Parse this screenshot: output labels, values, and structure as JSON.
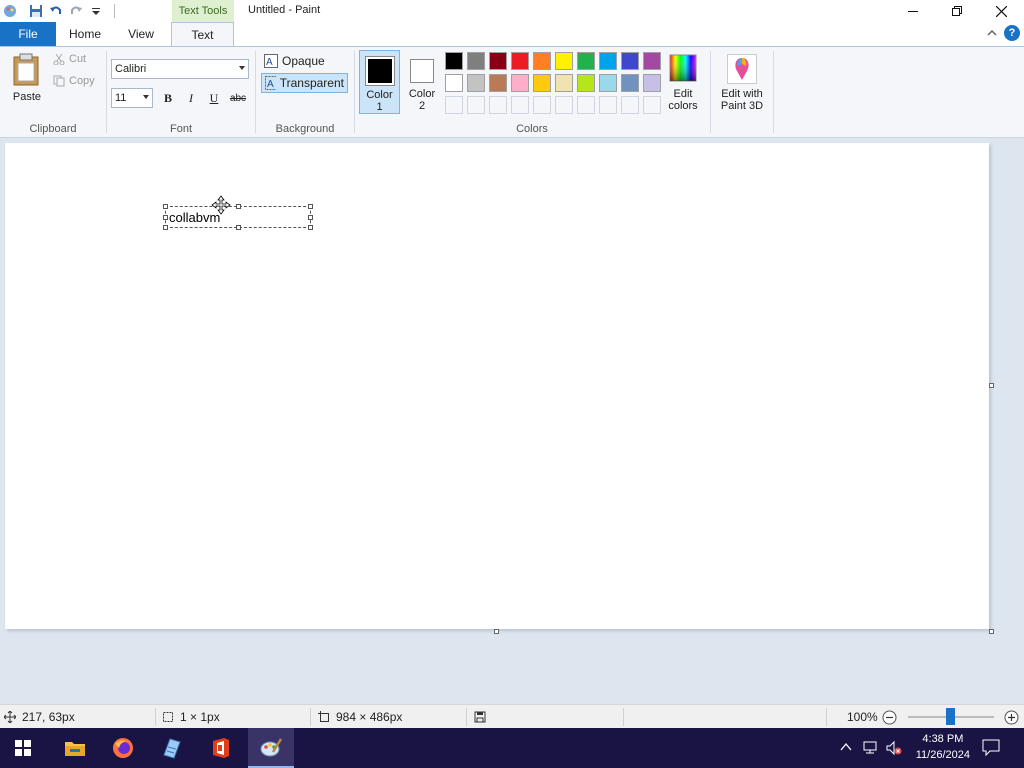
{
  "window": {
    "title": "Untitled - Paint",
    "context_tab": "Text Tools"
  },
  "tabs": {
    "file": "File",
    "home": "Home",
    "view": "View",
    "text": "Text"
  },
  "ribbon": {
    "clipboard": {
      "paste": "Paste",
      "cut": "Cut",
      "copy": "Copy",
      "label": "Clipboard"
    },
    "font": {
      "family": "Calibri",
      "size": "11",
      "bold": "B",
      "italic": "I",
      "underline": "U",
      "strike": "abc",
      "label": "Font"
    },
    "background": {
      "opaque": "Opaque",
      "transparent": "Transparent",
      "label": "Background"
    },
    "colors": {
      "color1": "Color\n1",
      "color1_line1": "Color",
      "color1_line2": "1",
      "color2_line1": "Color",
      "color2_line2": "2",
      "edit_colors_line1": "Edit",
      "edit_colors_line2": "colors",
      "label": "Colors",
      "color1_value": "#000000",
      "color2_value": "#ffffff",
      "palette_row1": [
        "#000000",
        "#7f7f7f",
        "#880015",
        "#ed1c24",
        "#ff7f27",
        "#fff200",
        "#22b14c",
        "#00a2e8",
        "#3f48cc",
        "#a349a4"
      ],
      "palette_row2": [
        "#ffffff",
        "#c3c3c3",
        "#b97a57",
        "#ffaec9",
        "#ffc90e",
        "#efe4b0",
        "#b5e61d",
        "#99d9ea",
        "#7092be",
        "#c8bfe7"
      ]
    },
    "paint3d": {
      "line1": "Edit with",
      "line2": "Paint 3D"
    }
  },
  "canvas": {
    "text": "collabvm"
  },
  "status": {
    "cursor": "217, 63px",
    "selection": "1 × 1px",
    "size": "984 × 486px",
    "zoom": "100%"
  },
  "taskbar": {
    "time": "4:38 PM",
    "date": "11/26/2024"
  },
  "colors": {
    "accent": "#1a72c6",
    "taskbar": "#1a1444",
    "selected": "#cce4f7"
  }
}
